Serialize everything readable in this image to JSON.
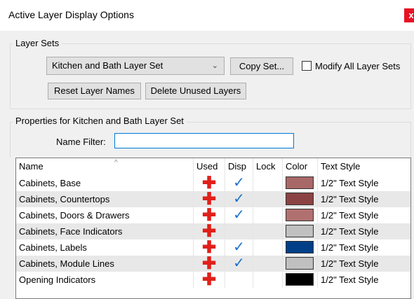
{
  "window": {
    "title": "Active Layer Display Options",
    "close_label": "x"
  },
  "layer_sets": {
    "group_label": "Layer Sets",
    "selected_set": "Kitchen and Bath Layer Set",
    "copy_set_label": "Copy Set...",
    "modify_all_label": "Modify All Layer Sets",
    "reset_names_label": "Reset Layer Names",
    "delete_unused_label": "Delete Unused Layers"
  },
  "properties": {
    "group_label": "Properties for Kitchen and Bath Layer Set",
    "name_filter_label": "Name Filter:",
    "name_filter_value": ""
  },
  "table": {
    "columns": [
      "Name",
      "Used",
      "Disp",
      "Lock",
      "Color",
      "Text Style"
    ],
    "rows": [
      {
        "name": "Cabinets,  Base",
        "used": "✚",
        "disp": "✓",
        "lock": "",
        "color": "#a86868",
        "text_style": "1/2\" Text Style"
      },
      {
        "name": "Cabinets, Countertops",
        "used": "✚",
        "disp": "✓",
        "lock": "",
        "color": "#8b4343",
        "text_style": "1/2\" Text Style"
      },
      {
        "name": "Cabinets, Doors & Drawers",
        "used": "✚",
        "disp": "✓",
        "lock": "",
        "color": "#b07070",
        "text_style": "1/2\" Text Style"
      },
      {
        "name": "Cabinets, Face Indicators",
        "used": "✚",
        "disp": "",
        "lock": "",
        "color": "#c0c0c0",
        "text_style": "1/2\" Text Style"
      },
      {
        "name": "Cabinets, Labels",
        "used": "✚",
        "disp": "✓",
        "lock": "",
        "color": "#003f87",
        "text_style": "1/2\" Text Style"
      },
      {
        "name": "Cabinets, Module Lines",
        "used": "✚",
        "disp": "✓",
        "lock": "",
        "color": "#c0c0c0",
        "text_style": "1/2\" Text Style"
      },
      {
        "name": "Opening Indicators",
        "used": "✚",
        "disp": "",
        "lock": "",
        "color": "#000000",
        "text_style": "1/2\" Text Style"
      }
    ]
  }
}
